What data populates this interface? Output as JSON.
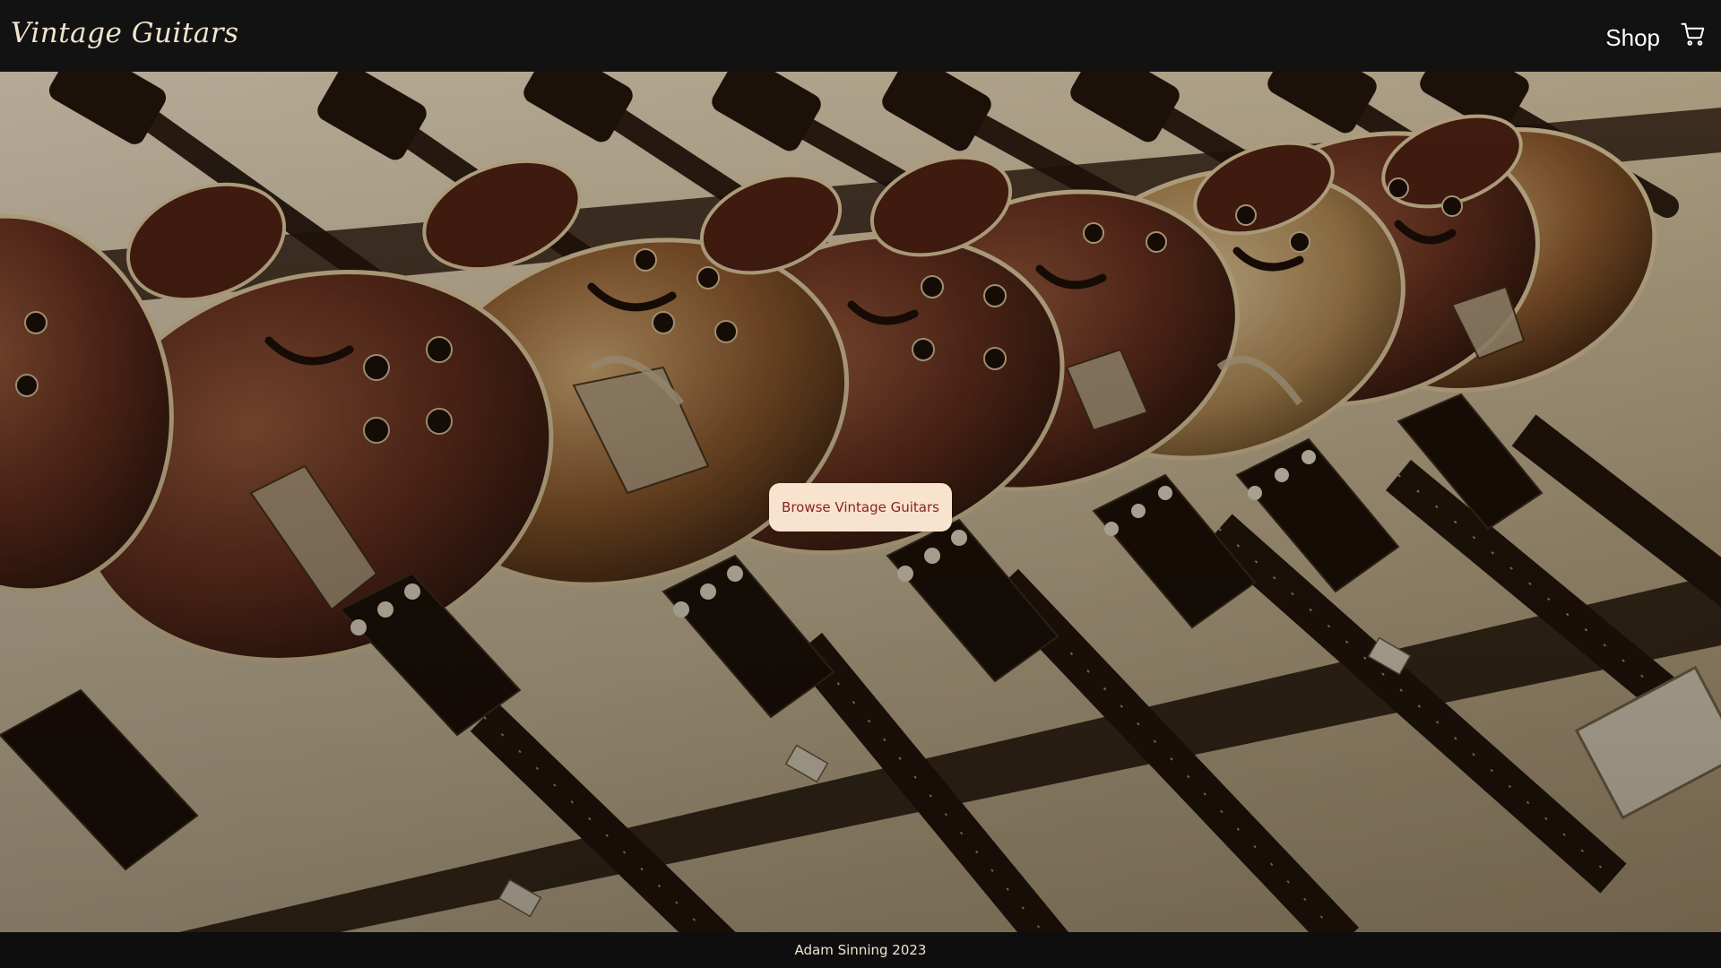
{
  "navbar": {
    "brand": "Vintage Guitars",
    "shop_label": "Shop",
    "cart_icon": "shopping-cart-icon"
  },
  "hero": {
    "image_subject": "wall of vintage archtop electric guitars in sepia tone",
    "cta_label": "Browse Vintage Guitars"
  },
  "footer": {
    "credit": "Adam Sinning 2023"
  },
  "colors": {
    "navbar_bg": "#121212",
    "brand_text": "#f1e4cd",
    "cta_bg": "#f8e3cf",
    "cta_text": "#8a2222",
    "footer_bg": "#0e0e0e"
  }
}
